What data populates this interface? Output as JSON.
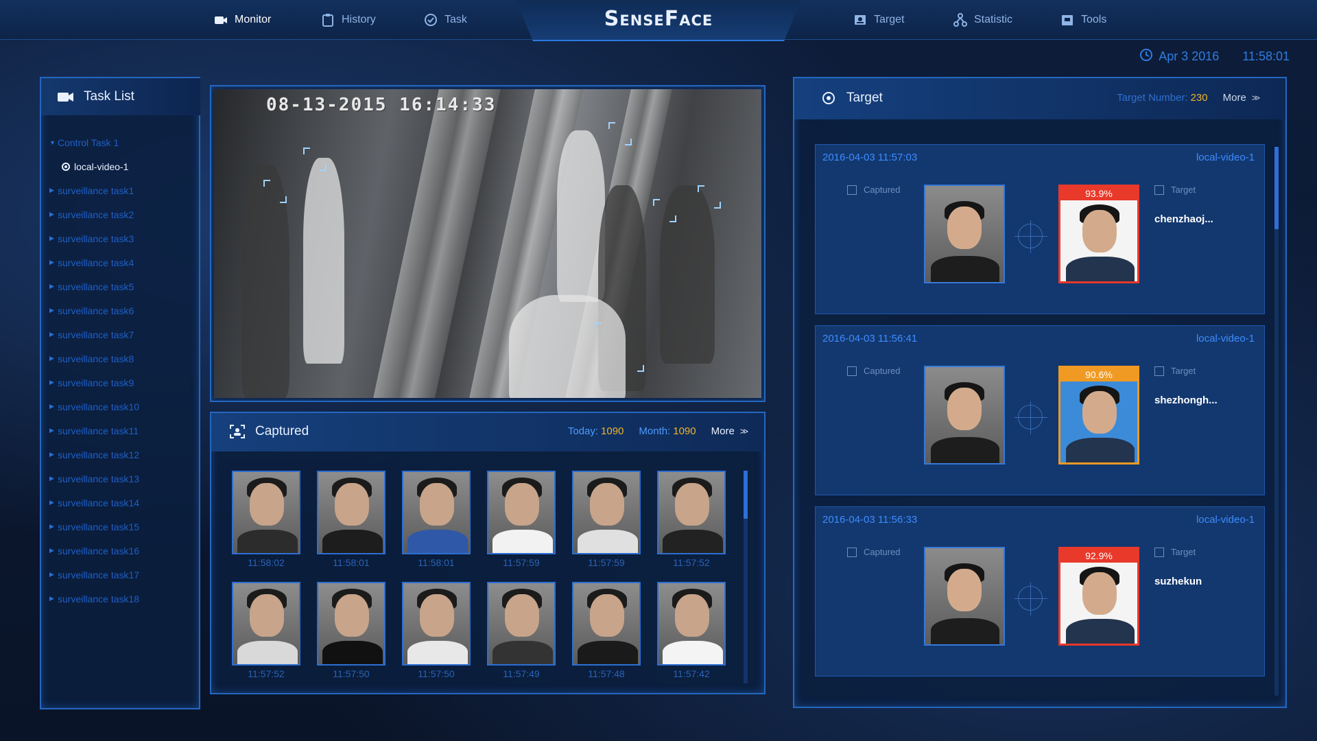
{
  "nav": {
    "items": [
      {
        "label": "Monitor",
        "icon": "camera-icon",
        "active": true
      },
      {
        "label": "History",
        "icon": "clipboard-icon",
        "active": false
      },
      {
        "label": "Task",
        "icon": "check-circle-icon",
        "active": false
      },
      {
        "label": "Target",
        "icon": "id-card-icon",
        "active": false
      },
      {
        "label": "Statistic",
        "icon": "network-icon",
        "active": false
      },
      {
        "label": "Tools",
        "icon": "toolbox-icon",
        "active": false
      }
    ],
    "logo": "SenseFace"
  },
  "clock": {
    "date": "Apr 3 2016",
    "time": "11:58:01"
  },
  "task_list": {
    "title": "Task List",
    "root": "Control Task 1",
    "child": "local-video-1",
    "tasks": [
      "surveillance task1",
      "surveillance task2",
      "surveillance task3",
      "surveillance task4",
      "surveillance task5",
      "surveillance task6",
      "surveillance task7",
      "surveillance task8",
      "surveillance task9",
      "surveillance task10",
      "surveillance task11",
      "surveillance task12",
      "surveillance task13",
      "surveillance task14",
      "surveillance task15",
      "surveillance task16",
      "surveillance task17",
      "surveillance task18"
    ]
  },
  "video": {
    "timestamp": "08-13-2015  16:14:33"
  },
  "captured": {
    "title": "Captured",
    "today_label": "Today:",
    "today": "1090",
    "month_label": "Month:",
    "month": "1090",
    "more": "More",
    "times": [
      "11:58:02",
      "11:58:01",
      "11:58:01",
      "11:57:59",
      "11:57:59",
      "11:57:52",
      "11:57:52",
      "11:57:50",
      "11:57:50",
      "11:57:49",
      "11:57:48",
      "11:57:42"
    ]
  },
  "target": {
    "title": "Target",
    "number_label": "Target Number:",
    "number": "230",
    "more": "More",
    "captured_label": "Captured",
    "target_label": "Target",
    "matches": [
      {
        "time": "2016-04-03 11:57:03",
        "source": "local-video-1",
        "score": "93.9%",
        "name": "chenzhaoj...",
        "badge": "red",
        "bg": "light"
      },
      {
        "time": "2016-04-03 11:56:41",
        "source": "local-video-1",
        "score": "90.6%",
        "name": "shezhongh...",
        "badge": "orange",
        "bg": "blue"
      },
      {
        "time": "2016-04-03 11:56:33",
        "source": "local-video-1",
        "score": "92.9%",
        "name": "suzhekun",
        "badge": "red",
        "bg": "light"
      }
    ]
  },
  "colors": {
    "accent": "#2f7de0",
    "score_red": "#e8392a",
    "score_orange": "#f09a23",
    "highlight": "#f0b429"
  }
}
